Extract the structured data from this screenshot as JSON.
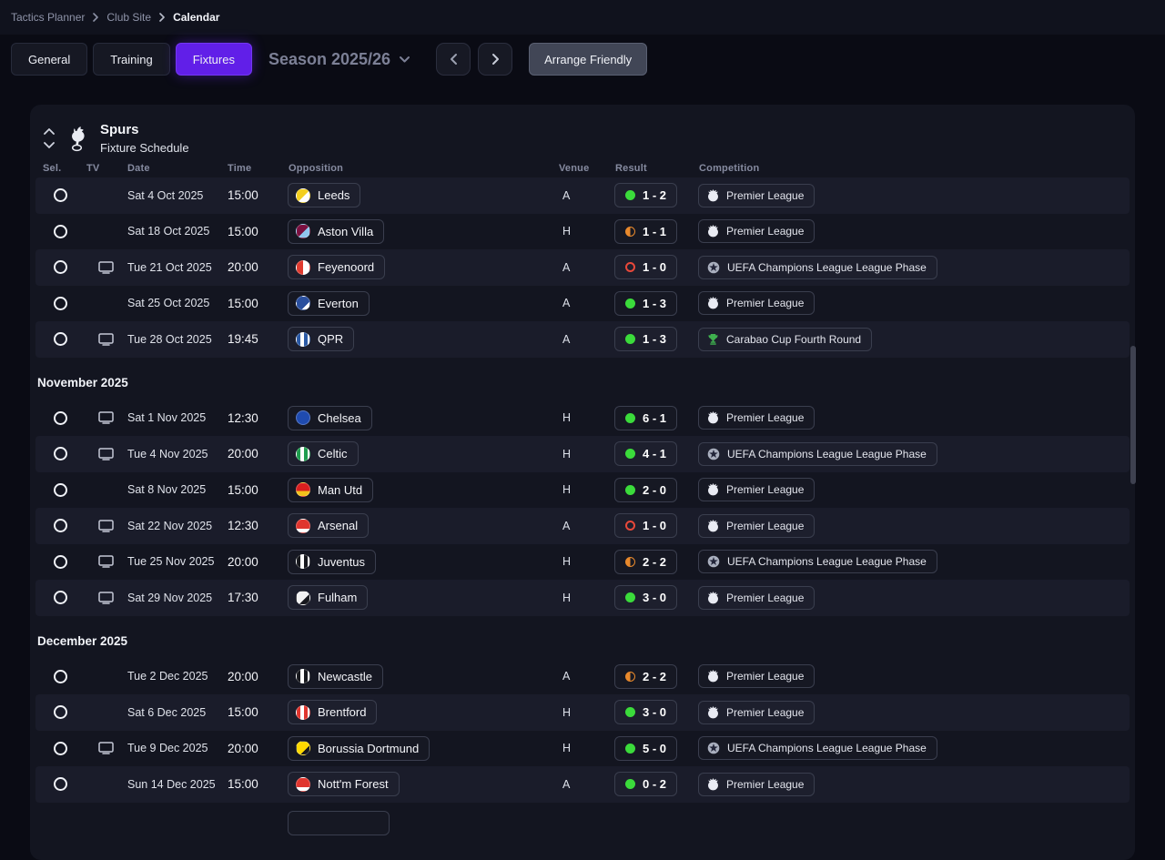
{
  "breadcrumb": {
    "items": [
      {
        "label": "Tactics Planner"
      },
      {
        "label": "Club Site"
      },
      {
        "label": "Calendar"
      }
    ]
  },
  "toolbar": {
    "tabs": [
      {
        "label": "General",
        "active": false
      },
      {
        "label": "Training",
        "active": false
      },
      {
        "label": "Fixtures",
        "active": true
      }
    ],
    "season_label": "Season 2025/26",
    "arrange_friendly_label": "Arrange Friendly"
  },
  "panel": {
    "team_name": "Spurs",
    "subtitle": "Fixture Schedule"
  },
  "colors": {
    "accent_purple": "#611fe8",
    "win_green": "#3bdb3b",
    "draw_orange": "#e8892c",
    "loss_red": "#e8483a"
  },
  "table": {
    "headers": {
      "sel": "Sel.",
      "tv": "TV",
      "date": "Date",
      "time": "Time",
      "opposition": "Opposition",
      "venue": "Venue",
      "result": "Result",
      "competition": "Competition"
    },
    "groups": [
      {
        "month": null,
        "rows": [
          {
            "tv": false,
            "date": "Sat 4 Oct 2025",
            "time": "15:00",
            "team": "Leeds",
            "crest": "linear-gradient(135deg,#f3cf1e 55%,#ffffff 55%)",
            "venue": "A",
            "score": "1 - 2",
            "outcome": "win",
            "competition": "Premier League",
            "competition_type": "premier-league"
          },
          {
            "tv": false,
            "date": "Sat 18 Oct 2025",
            "time": "15:00",
            "team": "Aston Villa",
            "crest": "linear-gradient(135deg,#7a1040 55%,#8fc6ee 55%)",
            "venue": "H",
            "score": "1 - 1",
            "outcome": "draw",
            "competition": "Premier League",
            "competition_type": "premier-league"
          },
          {
            "tv": true,
            "date": "Tue 21 Oct 2025",
            "time": "20:00",
            "team": "Feyenoord",
            "crest": "linear-gradient(90deg,#e03a2f 50%,#ffffff 50%)",
            "venue": "A",
            "score": "1 - 0",
            "outcome": "loss",
            "competition": "UEFA Champions League League Phase",
            "competition_type": "ucl"
          },
          {
            "tv": false,
            "date": "Sat 25 Oct 2025",
            "time": "15:00",
            "team": "Everton",
            "crest": "linear-gradient(135deg,#2a4f9e 70%,#ffffff 70%)",
            "venue": "A",
            "score": "1 - 3",
            "outcome": "win",
            "competition": "Premier League",
            "competition_type": "premier-league"
          },
          {
            "tv": true,
            "date": "Tue 28 Oct 2025",
            "time": "19:45",
            "team": "QPR",
            "crest": "repeating-linear-gradient(90deg,#2b5aa6 0 4px,#ffffff 4px 8px)",
            "venue": "A",
            "score": "1 - 3",
            "outcome": "win",
            "competition": "Carabao Cup Fourth Round",
            "competition_type": "carabao"
          }
        ]
      },
      {
        "month": "November 2025",
        "rows": [
          {
            "tv": true,
            "date": "Sat 1 Nov 2025",
            "time": "12:30",
            "team": "Chelsea",
            "crest": "#1f4bb0",
            "venue": "H",
            "score": "6 - 1",
            "outcome": "win",
            "competition": "Premier League",
            "competition_type": "premier-league"
          },
          {
            "tv": true,
            "date": "Tue 4 Nov 2025",
            "time": "20:00",
            "team": "Celtic",
            "crest": "repeating-linear-gradient(90deg,#1f9d4e 0 4px,#ffffff 4px 8px)",
            "venue": "H",
            "score": "4 - 1",
            "outcome": "win",
            "competition": "UEFA Champions League League Phase",
            "competition_type": "ucl"
          },
          {
            "tv": false,
            "date": "Sat 8 Nov 2025",
            "time": "15:00",
            "team": "Man Utd",
            "crest": "linear-gradient(180deg,#d81f1f 62%,#f3c21a 62%)",
            "venue": "H",
            "score": "2 - 0",
            "outcome": "win",
            "competition": "Premier League",
            "competition_type": "premier-league"
          },
          {
            "tv": true,
            "date": "Sat 22 Nov 2025",
            "time": "12:30",
            "team": "Arsenal",
            "crest": "linear-gradient(180deg,#e0352e 70%,#ffffff 70%)",
            "venue": "A",
            "score": "1 - 0",
            "outcome": "loss",
            "competition": "Premier League",
            "competition_type": "premier-league"
          },
          {
            "tv": true,
            "date": "Tue 25 Nov 2025",
            "time": "20:00",
            "team": "Juventus",
            "crest": "repeating-linear-gradient(90deg,#17181d 0 4px,#ffffff 4px 8px)",
            "venue": "H",
            "score": "2 - 2",
            "outcome": "draw",
            "competition": "UEFA Champions League League Phase",
            "competition_type": "ucl"
          },
          {
            "tv": true,
            "date": "Sat 29 Nov 2025",
            "time": "17:30",
            "team": "Fulham",
            "crest": "linear-gradient(135deg,#f2f2f2 60%,#17181d 60%)",
            "venue": "H",
            "score": "3 - 0",
            "outcome": "win",
            "competition": "Premier League",
            "competition_type": "premier-league"
          }
        ]
      },
      {
        "month": "December 2025",
        "rows": [
          {
            "tv": false,
            "date": "Tue 2 Dec 2025",
            "time": "20:00",
            "team": "Newcastle",
            "crest": "repeating-linear-gradient(90deg,#17181d 0 4px,#ffffff 4px 8px)",
            "venue": "A",
            "score": "2 - 2",
            "outcome": "draw",
            "competition": "Premier League",
            "competition_type": "premier-league"
          },
          {
            "tv": false,
            "date": "Sat 6 Dec 2025",
            "time": "15:00",
            "team": "Brentford",
            "crest": "repeating-linear-gradient(90deg,#e0352e 0 4px,#ffffff 4px 8px)",
            "venue": "H",
            "score": "3 - 0",
            "outcome": "win",
            "competition": "Premier League",
            "competition_type": "premier-league"
          },
          {
            "tv": true,
            "date": "Tue 9 Dec 2025",
            "time": "20:00",
            "team": "Borussia Dortmund",
            "crest": "linear-gradient(135deg,#ffd900 65%,#17181d 65%)",
            "venue": "H",
            "score": "5 - 0",
            "outcome": "win",
            "competition": "UEFA Champions League League Phase",
            "competition_type": "ucl"
          },
          {
            "tv": false,
            "date": "Sun 14 Dec 2025",
            "time": "15:00",
            "team": "Nott'm Forest",
            "crest": "linear-gradient(180deg,#e0352e 70%,#ffffff 70%)",
            "venue": "A",
            "score": "0 - 2",
            "outcome": "win",
            "competition": "Premier League",
            "competition_type": "premier-league"
          }
        ]
      }
    ]
  }
}
